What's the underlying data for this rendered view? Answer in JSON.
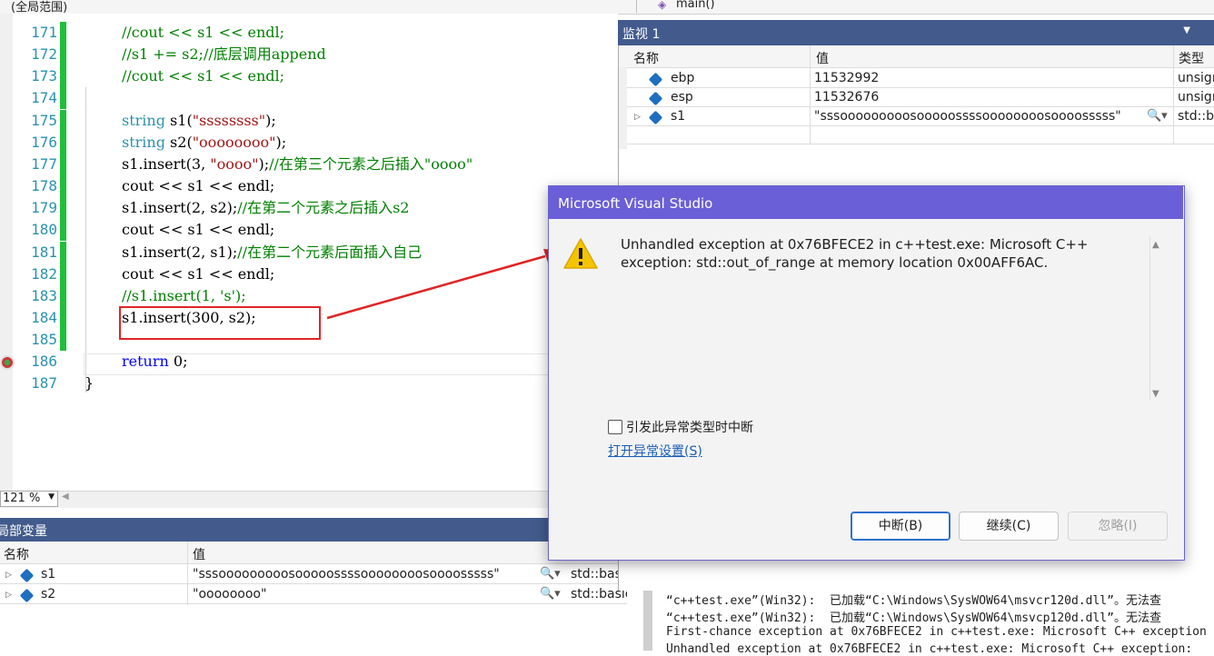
{
  "scope": {
    "left": "(全局范围)",
    "right": "main()"
  },
  "editor": {
    "lines": [
      {
        "num": "171",
        "segments": [
          {
            "t": "//cout << s1 << endl;",
            "c": "cm"
          }
        ]
      },
      {
        "num": "172",
        "segments": [
          {
            "t": "//s1 += s2;//底层调用append",
            "c": "cm"
          }
        ]
      },
      {
        "num": "173",
        "segments": [
          {
            "t": "//cout << s1 << endl;",
            "c": "cm"
          }
        ]
      },
      {
        "num": "174",
        "segments": []
      },
      {
        "num": "175",
        "segments": [
          {
            "t": "string ",
            "c": "ty"
          },
          {
            "t": "s1(",
            "c": ""
          },
          {
            "t": "\"ssssssss\"",
            "c": "st"
          },
          {
            "t": ");",
            "c": ""
          }
        ]
      },
      {
        "num": "176",
        "segments": [
          {
            "t": "string ",
            "c": "ty"
          },
          {
            "t": "s2(",
            "c": ""
          },
          {
            "t": "\"oooooooo\"",
            "c": "st"
          },
          {
            "t": ");",
            "c": ""
          }
        ]
      },
      {
        "num": "177",
        "segments": [
          {
            "t": "s1.insert(3, ",
            "c": ""
          },
          {
            "t": "\"oooo\"",
            "c": "st"
          },
          {
            "t": ");",
            "c": ""
          },
          {
            "t": "//在第三个元素之后插入\"oooo\"",
            "c": "cm"
          }
        ]
      },
      {
        "num": "178",
        "segments": [
          {
            "t": "cout << s1 << endl;",
            "c": ""
          }
        ]
      },
      {
        "num": "179",
        "segments": [
          {
            "t": "s1.insert(2, s2);",
            "c": ""
          },
          {
            "t": "//在第二个元素之后插入s2",
            "c": "cm"
          }
        ]
      },
      {
        "num": "180",
        "segments": [
          {
            "t": "cout << s1 << endl;",
            "c": ""
          }
        ]
      },
      {
        "num": "181",
        "segments": [
          {
            "t": "s1.insert(2, s1);",
            "c": ""
          },
          {
            "t": "//在第二个元素后面插入自己",
            "c": "cm"
          }
        ]
      },
      {
        "num": "182",
        "segments": [
          {
            "t": "cout << s1 << endl;",
            "c": ""
          }
        ]
      },
      {
        "num": "183",
        "segments": [
          {
            "t": "//s1.insert(1, 's');",
            "c": "cm"
          }
        ]
      },
      {
        "num": "184",
        "segments": [
          {
            "t": "s1.insert(300, s2);",
            "c": ""
          }
        ]
      },
      {
        "num": "185",
        "segments": []
      },
      {
        "num": "186",
        "segments": [
          {
            "t": "return ",
            "c": "kw"
          },
          {
            "t": "0;",
            "c": ""
          }
        ]
      },
      {
        "num": "187",
        "segments": [
          {
            "t": "}",
            "c": ""
          }
        ]
      }
    ],
    "zoom": "121 %"
  },
  "locals": {
    "title": "局部变量",
    "columns": [
      "名称",
      "值"
    ],
    "rows": [
      {
        "name": "s1",
        "value": "\"sssooooooooosooooossssoooooooosoooosssss\"",
        "type": "std::basic"
      },
      {
        "name": "s2",
        "value": "\"oooooooo\"",
        "type": "std::basic"
      }
    ]
  },
  "watch": {
    "title": "监视 1",
    "columns": [
      "名称",
      "值",
      "类型"
    ],
    "rows": [
      {
        "name": "ebp",
        "value": "11532992",
        "type": "unsign"
      },
      {
        "name": "esp",
        "value": "11532676",
        "type": "unsign"
      },
      {
        "name": "s1",
        "value": "\"sssooooooooosooooossssoooooooosoooosssss\"",
        "type": "std::ba"
      }
    ]
  },
  "output": {
    "lines": [
      "“c++test.exe”(Win32):  已加载“C:\\Windows\\SysWOW64\\msvcr120d.dll”。无法查",
      "“c++test.exe”(Win32):  已加载“C:\\Windows\\SysWOW64\\msvcp120d.dll”。无法查",
      "First-chance exception at 0x76BFECE2 in c++test.exe: Microsoft C++ exception",
      "Unhandled exception at 0x76BFECE2 in c++test.exe: Microsoft C++ exception: "
    ]
  },
  "dialog": {
    "title": "Microsoft Visual Studio",
    "message": "Unhandled exception at 0x76BFECE2 in c++test.exe: Microsoft C++ exception: std::out_of_range at memory location 0x00AFF6AC.",
    "checkbox_label": "引发此异常类型时中断",
    "link_label": "打开异常设置(S)",
    "buttons": {
      "break": "中断(B)",
      "continue": "继续(C)",
      "ignore": "忽略(I)"
    }
  },
  "colors": {
    "dialog_title": "#6a5fd6",
    "panel_title": "#425b8c",
    "annotation": "#e02424"
  }
}
